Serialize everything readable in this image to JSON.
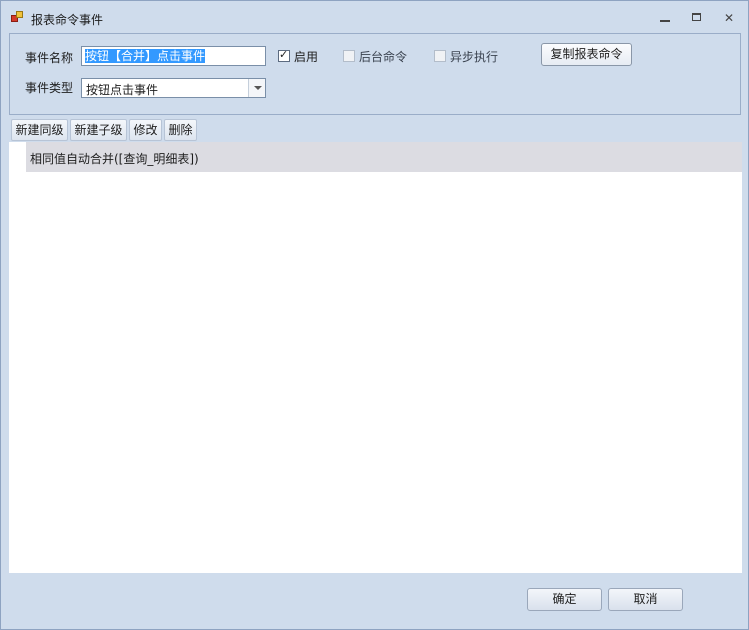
{
  "window": {
    "title": "报表命令事件"
  },
  "form": {
    "event_name_label": "事件名称",
    "event_name_value": "按钮【合并】点击事件",
    "enable_label": "启用",
    "enable_checked": true,
    "background_label": "后台命令",
    "async_label": "异步执行",
    "copy_button_label": "复制报表命令",
    "event_type_label": "事件类型",
    "event_type_value": "按钮点击事件"
  },
  "toolbar": {
    "new_sibling_label": "新建同级",
    "new_child_label": "新建子级",
    "edit_label": "修改",
    "delete_label": "删除"
  },
  "list": {
    "items": [
      "相同值自动合并([查询_明细表])"
    ]
  },
  "footer": {
    "ok_label": "确定",
    "cancel_label": "取消"
  }
}
